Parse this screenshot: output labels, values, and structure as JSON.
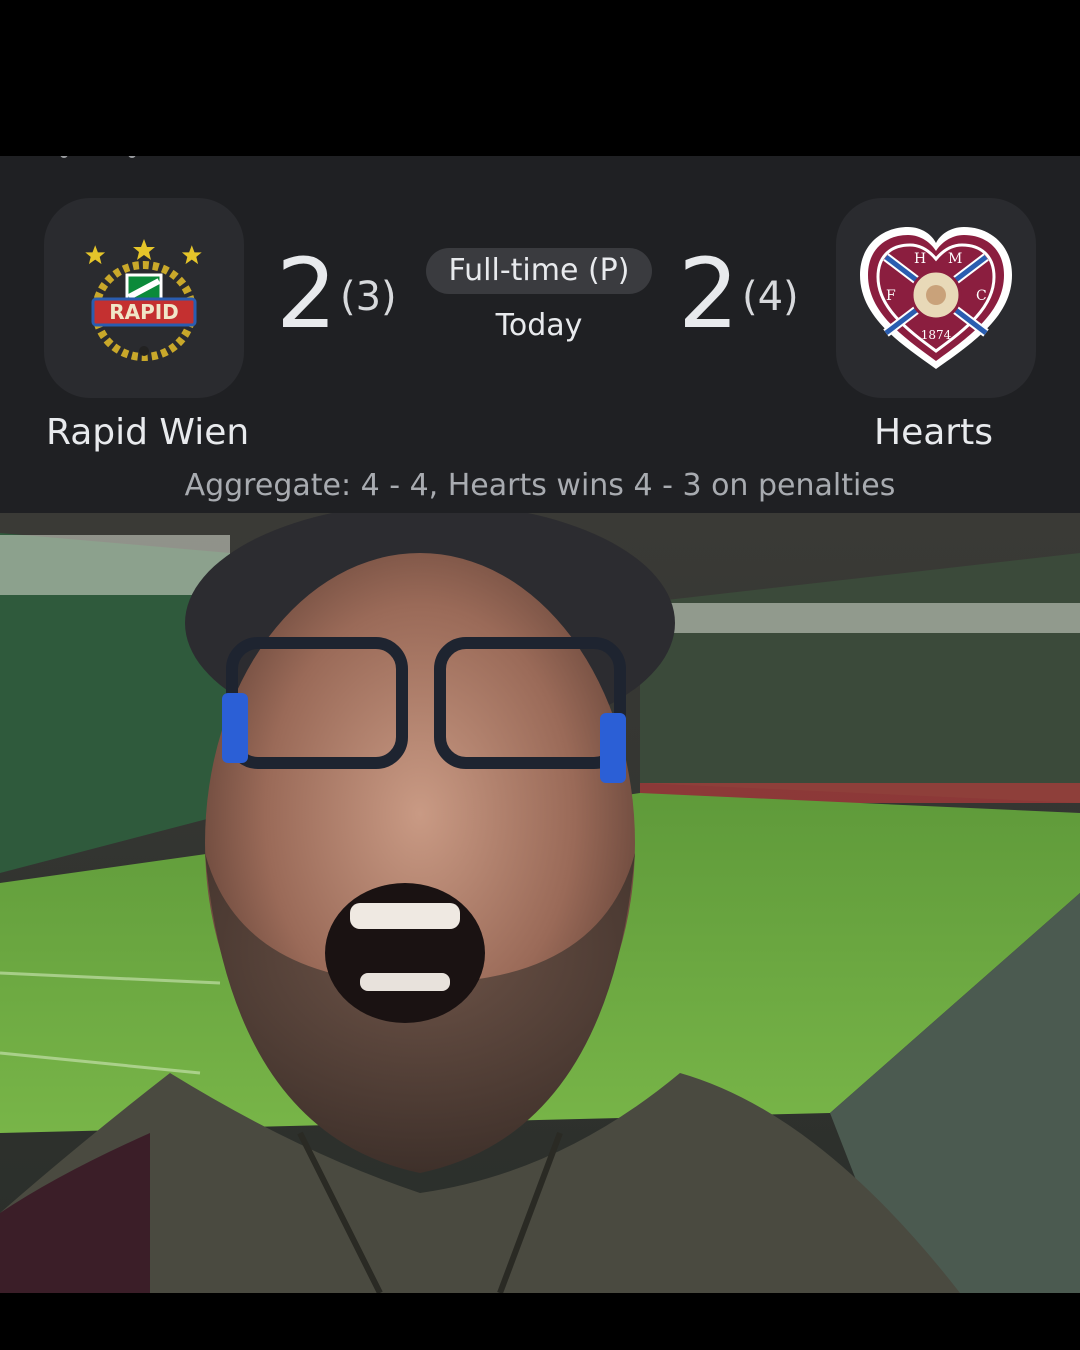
{
  "match": {
    "status": "Full-time (P)",
    "date": "Today",
    "home": {
      "name": "Rapid Wien",
      "score": "2",
      "penalties": "(3)",
      "crest_text": "RAPID"
    },
    "away": {
      "name": "Hearts",
      "score": "2",
      "penalties": "(4)",
      "crest_letters": [
        "H",
        "M",
        "F",
        "C"
      ],
      "crest_year": "1874"
    },
    "aggregate_text": "Aggregate: 4 - 4, Hearts wins 4 - 3 on penalties"
  },
  "colors": {
    "card_bg": "#1f2023",
    "crest_tile": "#2a2b2f",
    "pill_bg": "#3a3b3f",
    "text_primary": "#e8eaed",
    "text_secondary": "#a8abb0",
    "rapid_green": "#0b8a3a",
    "hearts_maroon": "#8b1e3f"
  },
  "photo": {
    "icon": "stadium-selfie-photo"
  }
}
